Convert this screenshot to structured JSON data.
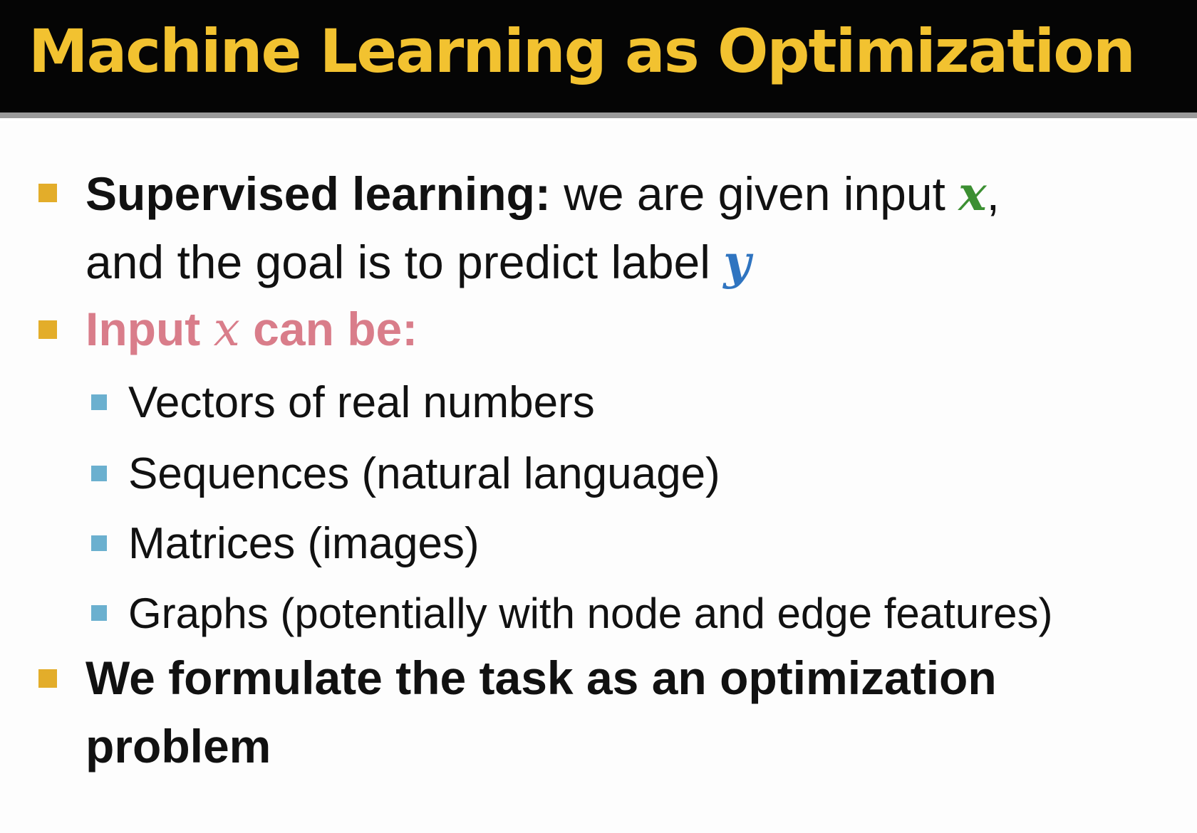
{
  "slide": {
    "title": "Machine Learning as Optimization"
  },
  "bullets": {
    "b1": {
      "lead": "Supervised learning:",
      "text_after_lead": " we are given input ",
      "var_x": "x",
      "comma": ",",
      "line2_text": "and the goal is to predict label ",
      "var_y": "y"
    },
    "b2": {
      "text_before": "Input ",
      "var_x": "x",
      "text_after": " can be:",
      "sub_items": [
        "Vectors of real numbers",
        "Sequences (natural language)",
        "Matrices (images)",
        "Graphs (potentially with node and edge features)"
      ]
    },
    "b3": {
      "line1": "We formulate the task as an optimization",
      "line2": "problem"
    }
  },
  "colors": {
    "title_bg": "#050505",
    "title_text": "#f2c230",
    "bullet_square": "#e3ad2a",
    "sub_bullet_square": "#6bb0cf",
    "var_x_green": "#3c8f32",
    "var_y_blue": "#2f74c0",
    "input_heading_pink": "#d97d8a"
  }
}
